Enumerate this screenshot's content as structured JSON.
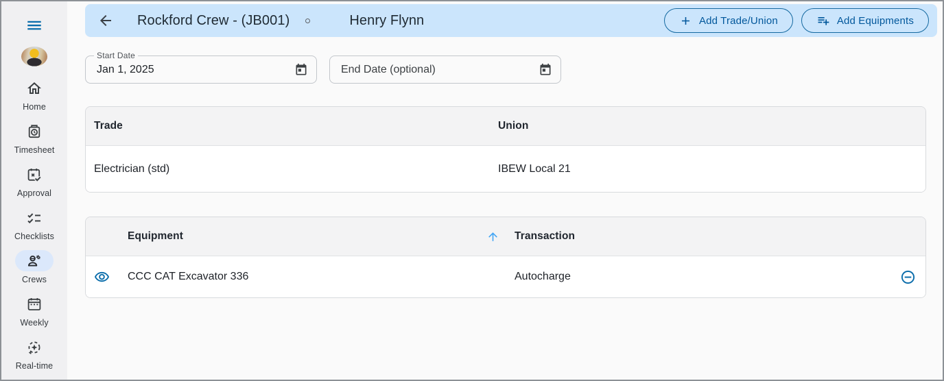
{
  "colors": {
    "topbar_bg": "#cbe5fc",
    "accent_blue": "#01579b",
    "hamburger_blue": "#0a6dab",
    "row_icon_blue": "#0b6dab",
    "sort_arrow_blue": "#42a5f5",
    "active_item_bg": "#dbe8fb",
    "sidebar_bg": "#f0f0f2"
  },
  "sidebar": {
    "items": [
      {
        "label": "Home",
        "icon": "home-icon",
        "active": false
      },
      {
        "label": "Timesheet",
        "icon": "timesheet-icon",
        "active": false
      },
      {
        "label": "Approval",
        "icon": "approval-icon",
        "active": false
      },
      {
        "label": "Checklists",
        "icon": "checklists-icon",
        "active": false
      },
      {
        "label": "Crews",
        "icon": "crews-icon",
        "active": true
      },
      {
        "label": "Weekly",
        "icon": "weekly-icon",
        "active": false
      },
      {
        "label": "Real-time",
        "icon": "realtime-icon",
        "active": false
      }
    ]
  },
  "header": {
    "crew_title": "Rockford Crew - (JB001)",
    "person_name": "Henry Flynn",
    "add_trade_union_label": "Add Trade/Union",
    "add_equipments_label": "Add Equipments"
  },
  "filters": {
    "start_date": {
      "label": "Start Date",
      "value": "Jan 1, 2025"
    },
    "end_date": {
      "placeholder": "End Date (optional)"
    }
  },
  "trade_table": {
    "columns": {
      "trade": "Trade",
      "union": "Union"
    },
    "rows": [
      {
        "trade": "Electrician (std)",
        "union": "IBEW Local 21"
      }
    ]
  },
  "equipment_table": {
    "columns": {
      "equipment": "Equipment",
      "transaction": "Transaction"
    },
    "sort": {
      "column": "Equipment",
      "direction": "ascending"
    },
    "rows": [
      {
        "equipment": "CCC CAT Excavator 336",
        "transaction": "Autocharge"
      }
    ]
  }
}
